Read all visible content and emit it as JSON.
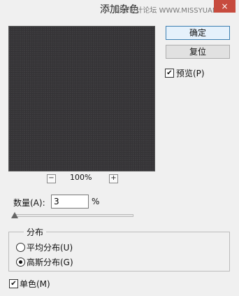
{
  "window": {
    "title": "添加杂色",
    "watermark": "思缘设计论坛 WWW.MISSYUAN.COM",
    "close_glyph": "×"
  },
  "zoom": {
    "minus_glyph": "−",
    "plus_glyph": "+",
    "level": "100%"
  },
  "buttons": {
    "ok": "确定",
    "reset": "复位"
  },
  "preview_option": {
    "label": "预览(P)",
    "checked": true,
    "check_glyph": "✔"
  },
  "amount": {
    "label": "数量(A):",
    "value": "3",
    "unit": "%",
    "slider_fraction": 0.008
  },
  "distribution": {
    "legend": "分布",
    "options": [
      {
        "label": "平均分布(U)",
        "selected": false
      },
      {
        "label": "高斯分布(G)",
        "selected": true
      }
    ]
  },
  "monochrome": {
    "label": "单色(M)",
    "checked": true,
    "check_glyph": "✔"
  },
  "colors": {
    "preview_bg": "#3d3c3f",
    "close_bg": "#c74b3e",
    "default_button_border": "#3c7fb1"
  }
}
